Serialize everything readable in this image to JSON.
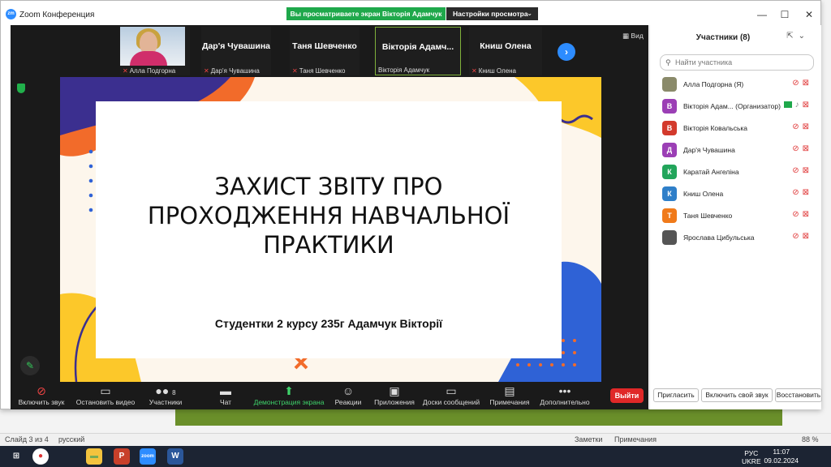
{
  "window": {
    "title": "Zoom Конференция",
    "minimize": "—",
    "maximize": "☐",
    "close": "✕"
  },
  "share_banner": {
    "text": "Вы просматриваете экран Вікторія Адамчук",
    "settings": "Настройки просмотра",
    "caret": "⌄"
  },
  "gallery": {
    "view_label": "Вид",
    "thumbnails": [
      {
        "name": "",
        "sub": "Алла Подгорна",
        "has_video": true,
        "muted": true
      },
      {
        "name": "Дар'я Чувашина",
        "sub": "Дар'я Чувашина",
        "muted": true
      },
      {
        "name": "Таня Шевченко",
        "sub": "Таня Шевченко",
        "muted": true
      },
      {
        "name": "Вікторія Адамч...",
        "sub": "Вікторія Адамчук",
        "muted": false,
        "active": true
      },
      {
        "name": "Книш Олена",
        "sub": "Книш Олена",
        "muted": true
      }
    ],
    "next_icon": "›"
  },
  "slide": {
    "title_line1": "ЗАХИСТ ЗВІТУ ПРО",
    "title_line2": "ПРОХОДЖЕННЯ НАВЧАЛЬНОЇ",
    "title_line3": "ПРАКТИКИ",
    "subtitle": "Студентки 2 курсу 235г Адамчук Вікторії",
    "colors": {
      "navy": "#3b2f8f",
      "orange": "#f26b2a",
      "yellow": "#fcc82a",
      "blue": "#2f62d6",
      "cream": "#fdf6ec"
    }
  },
  "toolbar": {
    "mute": {
      "label": "Включить звук",
      "icon": "🎤"
    },
    "video": {
      "label": "Остановить видео",
      "icon": "▭"
    },
    "participants": {
      "label": "Участники",
      "count": "8",
      "icon": "👥"
    },
    "chat": {
      "label": "Чат",
      "icon": "💬"
    },
    "share": {
      "label": "Демонстрация экрана",
      "icon": "⬆"
    },
    "reactions": {
      "label": "Реакции",
      "icon": "☺"
    },
    "apps": {
      "label": "Приложения",
      "icon": "▣"
    },
    "whiteboards": {
      "label": "Доски сообщений",
      "icon": "▭"
    },
    "notes": {
      "label": "Примечания",
      "icon": "▤"
    },
    "more": {
      "label": "Дополнительно",
      "icon": "•••"
    },
    "leave": "Выйти"
  },
  "participants_panel": {
    "title": "Участники (8)",
    "search_placeholder": "Найти участника",
    "list": [
      {
        "name": "Алла Подгорна (Я)",
        "initial": "",
        "color": "#8a8a6a",
        "photo": true
      },
      {
        "name": "Вікторія Адам... (Организатор)",
        "initial": "В",
        "color": "#9b3fb5",
        "host": true
      },
      {
        "name": "Вікторія Ковальська",
        "initial": "В",
        "color": "#d33a2c"
      },
      {
        "name": "Дар'я Чувашина",
        "initial": "Д",
        "color": "#9b3fb5"
      },
      {
        "name": "Каратай Ангеліна",
        "initial": "К",
        "color": "#22a55b"
      },
      {
        "name": "Книш Олена",
        "initial": "К",
        "color": "#2f7fc9"
      },
      {
        "name": "Таня Шевченко",
        "initial": "Т",
        "color": "#f07a1a"
      },
      {
        "name": "Ярослава Цибульська",
        "initial": "",
        "color": "#555555",
        "photo": true
      }
    ],
    "invite": "Пригласить",
    "unmute_me": "Включить свой звук",
    "reclaim": "Восстановить"
  },
  "ppt_status": {
    "slide": "Слайд 3 из 4",
    "lang": "русский",
    "notes": "Заметки",
    "comments": "Примечания",
    "zoom": "88 %"
  },
  "taskbar": {
    "lang": "РУС",
    "layout": "UKRE",
    "time": "11:07",
    "date": "09.02.2024"
  }
}
